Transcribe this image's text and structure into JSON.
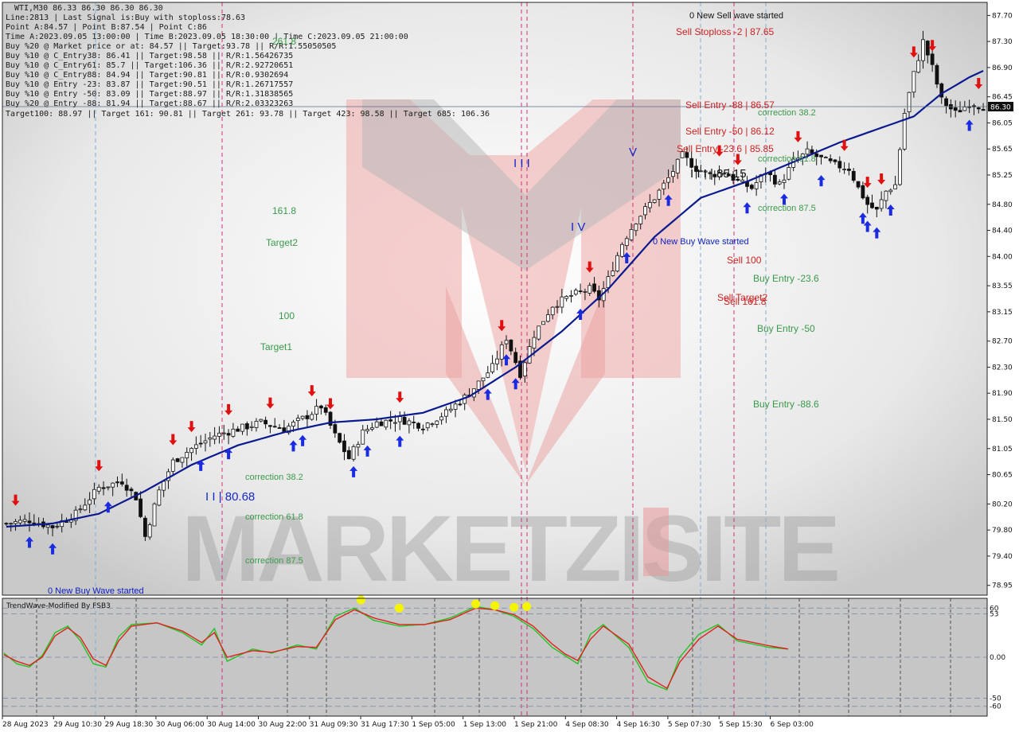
{
  "symbol_header": "WTI,M30  86.33 86.30 86.30 86.30",
  "info_lines": [
    "Line:2813 | Last Signal is:Buy with stoploss:78.63",
    "Point A:84.57 | Point B:87.54 | Point C:86",
    "Time A:2023.09.05 13:00:00 | Time B:2023.09.05 18:30:00 | Time C:2023.09.05 21:00:00",
    "Buy %20 @ Market price or at: 84.57 || Target:93.78 || R/R:1.55050505",
    "Buy %10 @ C_Entry38: 86.41 || Target:98.58 || R/R:1.56426735",
    "Buy %10 @ C_Entry61: 85.7 || Target:106.36 || R/R:2.92720651",
    "Buy %10 @ C_Entry88: 84.94 || Target:90.81 || R/R:0.9302694",
    "Buy %10 @ Entry -23: 83.87 || Target:90.51 || R/R:1.26717557",
    "Buy %10 @ Entry -50: 83.09 || Target:88.97 || R/R:1.31838565",
    "Buy %20 @ Entry -88: 81.94 || Target:88.67 || R/R:2.03323263",
    "Target100: 88.97 || Target 161: 90.81 || Target 261: 93.78 || Target 423: 98.58 || Target 685: 106.36"
  ],
  "current_price_label": "86.30",
  "indicator_title": "TrendWave-Modified By FSB3",
  "watermark_text": "MARKETZISITE",
  "chart_data": {
    "type": "candlestick",
    "symbol": "WTI",
    "timeframe": "M30",
    "ylim": [
      78.8,
      87.9
    ],
    "price_ticks": [
      "87.70",
      "87.30",
      "86.90",
      "86.45",
      "86.05",
      "85.65",
      "85.25",
      "84.80",
      "84.40",
      "84.00",
      "83.55",
      "83.15",
      "82.70",
      "82.30",
      "81.90",
      "81.50",
      "81.05",
      "80.65",
      "80.20",
      "79.80",
      "79.40",
      "78.95"
    ],
    "x_tick_labels": [
      "28 Aug 2023",
      "29 Aug 10:30",
      "29 Aug 18:30",
      "30 Aug 06:00",
      "30 Aug 14:00",
      "30 Aug 22:00",
      "31 Aug 09:30",
      "31 Aug 17:30",
      "1 Sep 05:00",
      "1 Sep 13:00",
      "1 Sep 21:00",
      "4 Sep 08:30",
      "4 Sep 16:30",
      "5 Sep 07:30",
      "5 Sep 15:30",
      "6 Sep 03:00"
    ],
    "close_path": [
      [
        0,
        79.9
      ],
      [
        5,
        79.95
      ],
      [
        10,
        79.85
      ],
      [
        15,
        80.05
      ],
      [
        20,
        80.45
      ],
      [
        25,
        80.55
      ],
      [
        28,
        80.3
      ],
      [
        30,
        79.7
      ],
      [
        33,
        80.4
      ],
      [
        36,
        80.85
      ],
      [
        40,
        81.05
      ],
      [
        45,
        81.25
      ],
      [
        50,
        81.35
      ],
      [
        55,
        81.45
      ],
      [
        60,
        81.35
      ],
      [
        65,
        81.55
      ],
      [
        68,
        81.7
      ],
      [
        71,
        81.25
      ],
      [
        74,
        80.9
      ],
      [
        77,
        81.3
      ],
      [
        80,
        81.45
      ],
      [
        85,
        81.5
      ],
      [
        90,
        81.4
      ],
      [
        95,
        81.6
      ],
      [
        100,
        81.9
      ],
      [
        105,
        82.3
      ],
      [
        108,
        82.75
      ],
      [
        111,
        82.2
      ],
      [
        114,
        82.8
      ],
      [
        118,
        83.25
      ],
      [
        122,
        83.4
      ],
      [
        126,
        83.5
      ],
      [
        128,
        83.35
      ],
      [
        130,
        83.65
      ],
      [
        133,
        84.2
      ],
      [
        136,
        84.55
      ],
      [
        140,
        84.9
      ],
      [
        143,
        85.2
      ],
      [
        146,
        85.55
      ],
      [
        149,
        85.35
      ],
      [
        152,
        85.25
      ],
      [
        155,
        85.3
      ],
      [
        158,
        85.15
      ],
      [
        161,
        85.05
      ],
      [
        164,
        85.3
      ],
      [
        167,
        85.1
      ],
      [
        170,
        85.45
      ],
      [
        173,
        85.6
      ],
      [
        176,
        85.5
      ],
      [
        179,
        85.4
      ],
      [
        182,
        85.35
      ],
      [
        184,
        85.05
      ],
      [
        186,
        84.8
      ],
      [
        188,
        84.7
      ],
      [
        190,
        85.0
      ],
      [
        192,
        85.1
      ],
      [
        194,
        86.2
      ],
      [
        196,
        86.8
      ],
      [
        198,
        87.3
      ],
      [
        200,
        86.9
      ],
      [
        202,
        86.4
      ],
      [
        205,
        86.2
      ],
      [
        208,
        86.35
      ],
      [
        211,
        86.3
      ]
    ],
    "ma_path": [
      [
        0,
        79.85
      ],
      [
        10,
        79.9
      ],
      [
        20,
        80.05
      ],
      [
        30,
        80.4
      ],
      [
        40,
        80.8
      ],
      [
        50,
        81.1
      ],
      [
        60,
        81.3
      ],
      [
        70,
        81.45
      ],
      [
        80,
        81.5
      ],
      [
        90,
        81.6
      ],
      [
        100,
        81.85
      ],
      [
        110,
        82.3
      ],
      [
        120,
        82.85
      ],
      [
        130,
        83.5
      ],
      [
        140,
        84.3
      ],
      [
        150,
        84.9
      ],
      [
        160,
        85.15
      ],
      [
        170,
        85.45
      ],
      [
        180,
        85.75
      ],
      [
        190,
        86.0
      ],
      [
        196,
        86.15
      ],
      [
        202,
        86.5
      ],
      [
        208,
        86.75
      ],
      [
        211,
        86.85
      ]
    ],
    "levels": [
      {
        "label": "261.8",
        "price": 87.5
      },
      {
        "label": "161.8",
        "price": 84.8
      },
      {
        "label": "Target2",
        "price": 84.25
      },
      {
        "label": "100",
        "price": 83.25
      },
      {
        "label": "Target1",
        "price": 82.7
      }
    ],
    "left_corrections": [
      "correction 38.2",
      "correction 61.8",
      "correction 87.5"
    ],
    "right_corrections": [
      "correction 38.2",
      "correction 61.8",
      "correction 87.5"
    ],
    "buy_entries": [
      "Buy Entry -23.6",
      "Buy Entry -50",
      "Buy Entry -88.6"
    ],
    "sell_labels": [
      "0 New Sell wave started",
      "Sell Stoploss -2 | 87.65",
      "Sell Entry -88 | 86.57",
      "Sell Entry -50 | 86.12",
      "Sell Entry -23.6 | 85.85",
      "Sell 100",
      "Sell Target2",
      "Sell 161.8"
    ],
    "wave_labels": [
      "I I | 80.68",
      "I I I",
      "I V",
      "V",
      "I I I | 85.15"
    ],
    "new_buy_labels": [
      "0 New Buy Wave started",
      "0 New Buy Wave started"
    ],
    "indicator": {
      "name": "TrendWave-Modified By FSB3",
      "ylim": [
        -70,
        70
      ],
      "ticks": [
        "60",
        "53",
        "0.00",
        "-50",
        "-60"
      ],
      "green_path": [
        [
          0,
          5
        ],
        [
          4,
          -8
        ],
        [
          8,
          -12
        ],
        [
          12,
          2
        ],
        [
          16,
          30
        ],
        [
          20,
          38
        ],
        [
          24,
          20
        ],
        [
          28,
          -8
        ],
        [
          32,
          -12
        ],
        [
          36,
          25
        ],
        [
          40,
          40
        ],
        [
          48,
          42
        ],
        [
          56,
          30
        ],
        [
          62,
          15
        ],
        [
          66,
          35
        ],
        [
          70,
          -5
        ],
        [
          78,
          10
        ],
        [
          84,
          5
        ],
        [
          92,
          15
        ],
        [
          98,
          10
        ],
        [
          104,
          50
        ],
        [
          110,
          60
        ],
        [
          116,
          45
        ],
        [
          124,
          38
        ],
        [
          132,
          40
        ],
        [
          140,
          48
        ],
        [
          148,
          62
        ],
        [
          154,
          58
        ],
        [
          160,
          50
        ],
        [
          166,
          35
        ],
        [
          172,
          12
        ],
        [
          176,
          2
        ],
        [
          180,
          -8
        ],
        [
          184,
          28
        ],
        [
          188,
          40
        ],
        [
          196,
          12
        ],
        [
          202,
          -30
        ],
        [
          208,
          -40
        ],
        [
          212,
          0
        ],
        [
          218,
          28
        ],
        [
          224,
          40
        ],
        [
          230,
          20
        ],
        [
          240,
          12
        ],
        [
          246,
          10
        ]
      ],
      "red_path": [
        [
          0,
          3
        ],
        [
          4,
          -5
        ],
        [
          8,
          -10
        ],
        [
          12,
          0
        ],
        [
          16,
          26
        ],
        [
          20,
          36
        ],
        [
          24,
          24
        ],
        [
          28,
          -2
        ],
        [
          32,
          -10
        ],
        [
          36,
          20
        ],
        [
          40,
          38
        ],
        [
          48,
          42
        ],
        [
          56,
          32
        ],
        [
          62,
          18
        ],
        [
          66,
          30
        ],
        [
          70,
          0
        ],
        [
          78,
          8
        ],
        [
          84,
          6
        ],
        [
          92,
          13
        ],
        [
          98,
          12
        ],
        [
          104,
          46
        ],
        [
          110,
          58
        ],
        [
          116,
          48
        ],
        [
          124,
          40
        ],
        [
          132,
          40
        ],
        [
          140,
          46
        ],
        [
          148,
          60
        ],
        [
          154,
          58
        ],
        [
          160,
          52
        ],
        [
          166,
          38
        ],
        [
          172,
          16
        ],
        [
          176,
          4
        ],
        [
          180,
          -4
        ],
        [
          184,
          22
        ],
        [
          188,
          38
        ],
        [
          196,
          16
        ],
        [
          202,
          -24
        ],
        [
          208,
          -38
        ],
        [
          212,
          -6
        ],
        [
          218,
          22
        ],
        [
          224,
          38
        ],
        [
          230,
          22
        ],
        [
          240,
          14
        ],
        [
          246,
          10
        ]
      ],
      "signal_dots": [
        [
          112,
          70
        ],
        [
          124,
          60
        ],
        [
          148,
          65
        ],
        [
          154,
          63
        ],
        [
          160,
          61
        ],
        [
          164,
          62
        ]
      ]
    }
  }
}
